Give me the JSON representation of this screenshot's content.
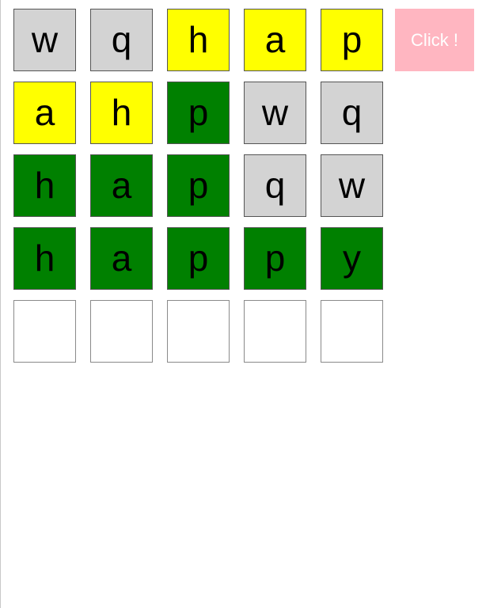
{
  "button": {
    "label": "Click !"
  },
  "colors": {
    "gray": "#d3d3d3",
    "yellow": "#ffff00",
    "green": "#008000",
    "empty": "#ffffff",
    "button": "#ffb6c1"
  },
  "board": {
    "rows": [
      [
        {
          "letter": "w",
          "state": "gray"
        },
        {
          "letter": "q",
          "state": "gray"
        },
        {
          "letter": "h",
          "state": "yellow"
        },
        {
          "letter": "a",
          "state": "yellow"
        },
        {
          "letter": "p",
          "state": "yellow"
        }
      ],
      [
        {
          "letter": "a",
          "state": "yellow"
        },
        {
          "letter": "h",
          "state": "yellow"
        },
        {
          "letter": "p",
          "state": "green"
        },
        {
          "letter": "w",
          "state": "gray"
        },
        {
          "letter": "q",
          "state": "gray"
        }
      ],
      [
        {
          "letter": "h",
          "state": "green"
        },
        {
          "letter": "a",
          "state": "green"
        },
        {
          "letter": "p",
          "state": "green"
        },
        {
          "letter": "q",
          "state": "gray"
        },
        {
          "letter": "w",
          "state": "gray"
        }
      ],
      [
        {
          "letter": "h",
          "state": "green"
        },
        {
          "letter": "a",
          "state": "green"
        },
        {
          "letter": "p",
          "state": "green"
        },
        {
          "letter": "p",
          "state": "green"
        },
        {
          "letter": "y",
          "state": "green"
        }
      ],
      [
        {
          "letter": "",
          "state": "empty"
        },
        {
          "letter": "",
          "state": "empty"
        },
        {
          "letter": "",
          "state": "empty"
        },
        {
          "letter": "",
          "state": "empty"
        },
        {
          "letter": "",
          "state": "empty"
        }
      ]
    ]
  }
}
